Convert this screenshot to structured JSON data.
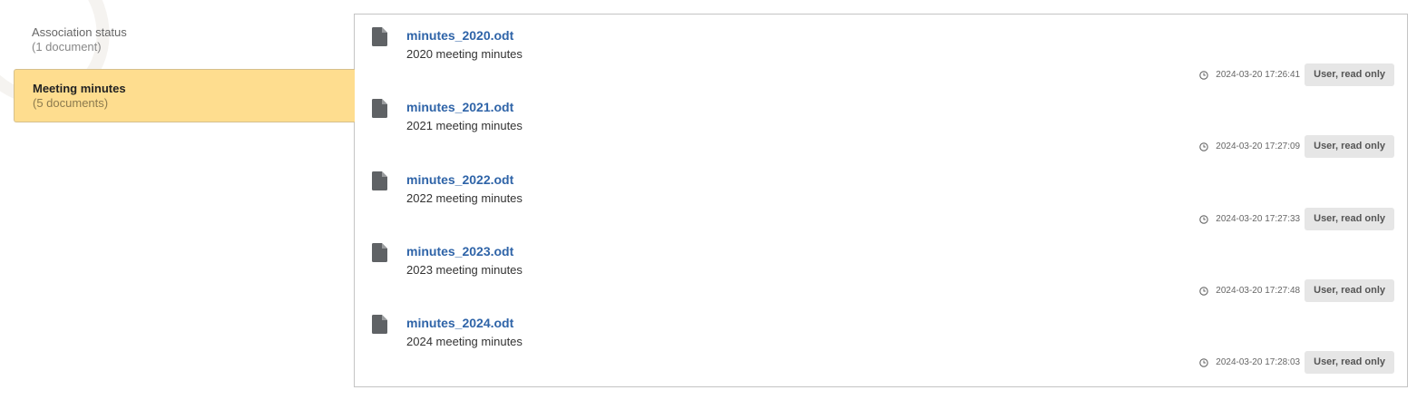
{
  "categories": [
    {
      "name": "Association status",
      "count": "(1 document)",
      "active": false
    },
    {
      "name": "Meeting minutes",
      "count": "(5 documents)",
      "active": true
    }
  ],
  "documents": [
    {
      "filename": "minutes_2020.odt",
      "description": "2020 meeting minutes",
      "timestamp": "2024-03-20 17:26:41",
      "access": "User, read only"
    },
    {
      "filename": "minutes_2021.odt",
      "description": "2021 meeting minutes",
      "timestamp": "2024-03-20 17:27:09",
      "access": "User, read only"
    },
    {
      "filename": "minutes_2022.odt",
      "description": "2022 meeting minutes",
      "timestamp": "2024-03-20 17:27:33",
      "access": "User, read only"
    },
    {
      "filename": "minutes_2023.odt",
      "description": "2023 meeting minutes",
      "timestamp": "2024-03-20 17:27:48",
      "access": "User, read only"
    },
    {
      "filename": "minutes_2024.odt",
      "description": "2024 meeting minutes",
      "timestamp": "2024-03-20 17:28:03",
      "access": "User, read only"
    }
  ],
  "icons": {
    "document": "file-icon",
    "time": "clock-icon"
  },
  "colors": {
    "active_category": "#fedd8f",
    "link": "#2f64a8",
    "badge": "#e6e6e6"
  }
}
